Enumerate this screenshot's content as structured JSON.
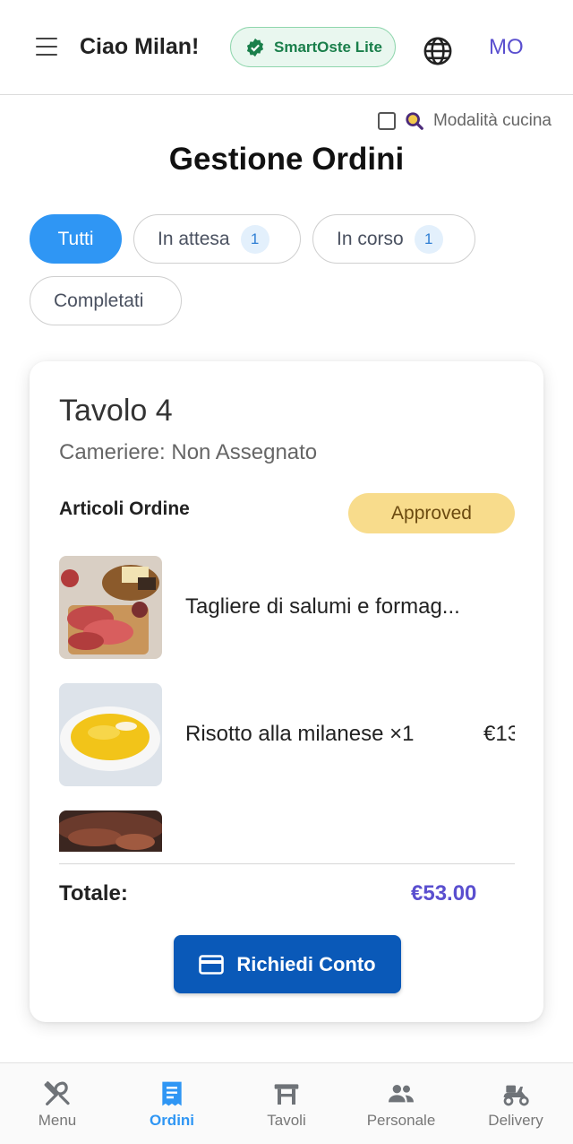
{
  "header": {
    "greeting": "Ciao Milan!",
    "plan_badge": "SmartOste Lite",
    "avatar_initials": "MO"
  },
  "kitchen_mode": {
    "label": "Modalità cucina",
    "checked": false
  },
  "page_title": "Gestione Ordini",
  "filters": [
    {
      "label": "Tutti",
      "count": null,
      "active": true
    },
    {
      "label": "In attesa",
      "count": "1",
      "active": false
    },
    {
      "label": "In corso",
      "count": "1",
      "active": false
    },
    {
      "label": "Completati",
      "count": null,
      "active": false
    }
  ],
  "order": {
    "table": "Tavolo 4",
    "waiter": "Cameriere: Non Assegnato",
    "items_title": "Articoli Ordine",
    "status": "Approved",
    "items": [
      {
        "name": "Tagliere di salumi e formag...",
        "price": ""
      },
      {
        "name": "Risotto alla milanese ×1",
        "price": "€13"
      },
      {
        "name": "",
        "price": ""
      }
    ],
    "total_label": "Totale:",
    "total_value": "€53.00",
    "bill_button": "Richiedi Conto"
  },
  "bottom_nav": [
    {
      "label": "Menu",
      "icon": "utensils-icon",
      "active": false
    },
    {
      "label": "Ordini",
      "icon": "receipt-icon",
      "active": true
    },
    {
      "label": "Tavoli",
      "icon": "table-icon",
      "active": false
    },
    {
      "label": "Personale",
      "icon": "people-icon",
      "active": false
    },
    {
      "label": "Delivery",
      "icon": "scooter-icon",
      "active": false
    }
  ],
  "colors": {
    "accent": "#2f96f4",
    "primary_button": "#0a59b8",
    "total": "#5a4fcf",
    "status_badge": "#f8dc8c"
  }
}
